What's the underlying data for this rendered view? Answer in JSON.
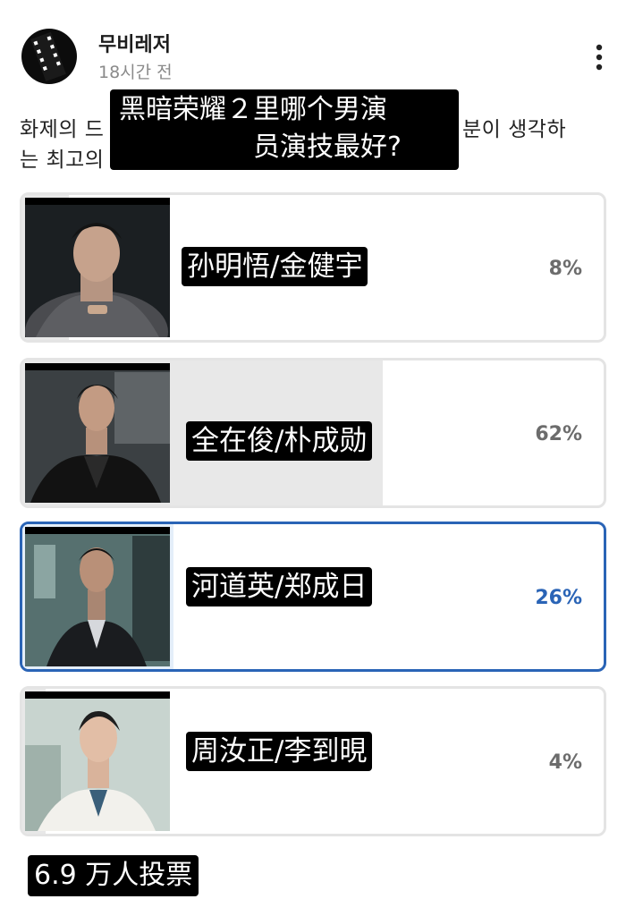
{
  "post": {
    "author": "무비레저",
    "time": "18시간 전",
    "text_line1": "화제의 드",
    "text_line1_right": "분이 생각하",
    "text_line2": "는 최고의"
  },
  "overlay": {
    "title_line1": "黑暗荣耀２里哪个男演",
    "title_line2": "员演技最好?"
  },
  "poll": {
    "options": [
      {
        "label": "孙明悟/金健宇",
        "percent": "8%",
        "value": 8,
        "selected": false
      },
      {
        "label": "全在俊/朴成勋",
        "percent": "62%",
        "value": 62,
        "selected": false
      },
      {
        "label": "河道英/郑成日",
        "percent": "26%",
        "value": 26,
        "selected": true
      },
      {
        "label": "周汝正/李到晛",
        "percent": "4%",
        "value": 4,
        "selected": false
      }
    ],
    "votes": "6.9 万人投票"
  },
  "colors": {
    "selected_accent": "#2a64b6",
    "bar_fill": "#e8e8e8",
    "selected_fill": "#e4eef9",
    "percent_text": "#6c6c6c"
  },
  "icons": {
    "more": "vertical-ellipsis-icon",
    "avatar": "film-strip-avatar"
  }
}
